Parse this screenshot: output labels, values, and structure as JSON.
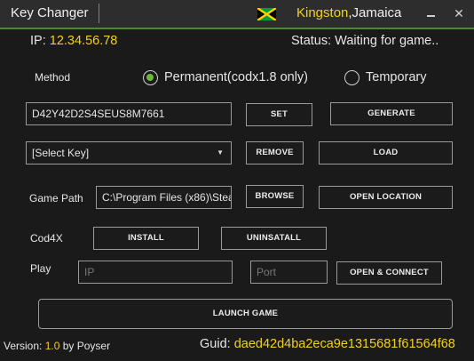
{
  "window": {
    "title": "Key Changer",
    "location_city": "Kingston",
    "location_country": ",Jamaica",
    "minimize_glyph": "_",
    "close_glyph": "✕",
    "flag_colors": {
      "green": "#009b3a",
      "yellow": "#fed100",
      "black": "#000000"
    }
  },
  "info": {
    "ip_label": "IP:",
    "ip_value": "12.34.56.78",
    "status_label": "Status:",
    "status_value": "Waiting for game.."
  },
  "method": {
    "label": "Method",
    "options": [
      {
        "label": "Permanent(codx1.8 only)",
        "selected": true
      },
      {
        "label": "Temporary",
        "selected": false
      }
    ]
  },
  "key": {
    "value": "D42Y42D2S4SEUS8M7661",
    "set_label": "SET",
    "generate_label": "GENERATE"
  },
  "select_key": {
    "value": "[Select Key]",
    "remove_label": "REMOVE",
    "load_label": "LOAD"
  },
  "game_path": {
    "label": "Game Path",
    "value": "C:\\Program Files (x86)\\Stea",
    "browse_label": "BROWSE",
    "open_location_label": "OPEN LOCATION"
  },
  "cod4x": {
    "label": "Cod4X",
    "install_label": "INSTALL",
    "uninstall_label": "UNINSATALL"
  },
  "play": {
    "label": "Play",
    "ip_placeholder": "IP",
    "port_placeholder": "Port",
    "connect_label": "OPEN & CONNECT"
  },
  "launch_label": "LAUNCH GAME",
  "footer": {
    "version_prefix": "Version: ",
    "version": "1.0",
    "version_suffix": " by Poyser",
    "guid_label": "Guid: ",
    "guid_value": "daed42d4ba2eca9e1315681f61564f68"
  },
  "colors": {
    "accent_green": "#5ea234",
    "highlight_yellow": "#f2d11b",
    "background": "#1a1a1a"
  }
}
